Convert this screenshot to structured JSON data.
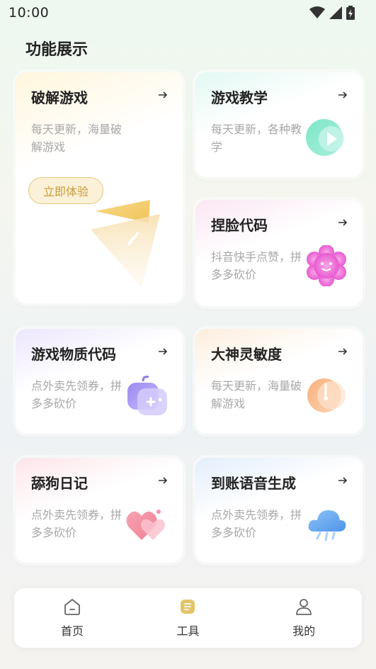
{
  "status": {
    "time": "10:00"
  },
  "page": {
    "title": "功能展示"
  },
  "cards": [
    {
      "title": "破解游戏",
      "desc": "每天更新，海量破解游戏",
      "button": "立即体验",
      "icon": "paper-plane-icon"
    },
    {
      "title": "游戏教学",
      "desc": "每天更新，各种教学",
      "icon": "play-icon"
    },
    {
      "title": "捏脸代码",
      "desc": "抖音快手点赞，拼多多砍价",
      "icon": "flower-face-icon"
    },
    {
      "title": "游戏物质代码",
      "desc": "点外卖先领券，拼多多砍价",
      "icon": "gamepad-icon"
    },
    {
      "title": "大神灵敏度",
      "desc": "每天更新，海量破解游戏",
      "icon": "clock-icon"
    },
    {
      "title": "舔狗日记",
      "desc": "点外卖先领券，拼多多砍价",
      "icon": "heart-icon"
    },
    {
      "title": "到账语音生成",
      "desc": "点外卖先领券，拼多多砍价",
      "icon": "cloud-icon"
    }
  ],
  "nav": {
    "items": [
      {
        "label": "首页",
        "icon": "home-icon"
      },
      {
        "label": "工具",
        "icon": "tools-icon",
        "active": true
      },
      {
        "label": "我的",
        "icon": "profile-icon"
      }
    ]
  },
  "colors": {
    "accent": "#e4c46a",
    "muted_text": "#a8a8a8"
  }
}
